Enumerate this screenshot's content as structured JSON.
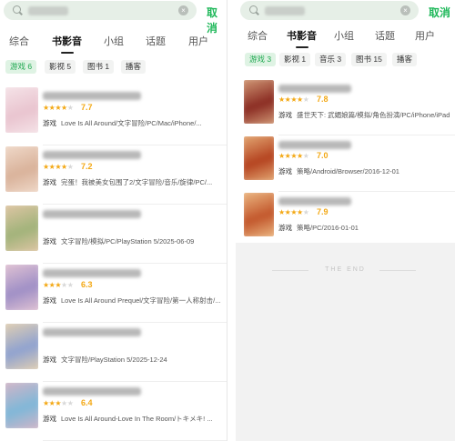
{
  "left": {
    "search": {
      "clear_glyph": "×",
      "cancel_label": "取消"
    },
    "tabs": [
      "综合",
      "书影音",
      "小组",
      "话题",
      "用户"
    ],
    "active_tab": "书影音",
    "filters": [
      "游戏 6",
      "影视 5",
      "图书 1",
      "播客"
    ],
    "active_filter": "游戏 6",
    "items": [
      {
        "stars": "★★★★",
        "stars_off": "★",
        "rating": "7.7",
        "type": "游戏",
        "meta": "Love Is All Around/文字冒险/PC/Mac/iPhone/...",
        "cover_colors": [
          "#e9c4cf",
          "#f6e6ea"
        ]
      },
      {
        "stars": "★★★★",
        "stars_off": "★",
        "rating": "7.2",
        "type": "游戏",
        "meta": "完蛋！我被美女包围了2/文字冒险/音乐/旋律/PC/...",
        "cover_colors": [
          "#d9b29a",
          "#f1dccd"
        ]
      },
      {
        "stars": "",
        "stars_off": "",
        "rating": "",
        "type": "游戏",
        "meta": "文字冒险/模拟/PC/PlayStation 5/2025-06-09",
        "cover_colors": [
          "#a1b37a",
          "#e4c7a8"
        ]
      },
      {
        "stars": "★★★",
        "stars_off": "★★",
        "rating": "6.3",
        "type": "游戏",
        "meta": "Love Is All Around Prequel/文字冒险/第一人称射击/...",
        "cover_colors": [
          "#9f8fc6",
          "#e6c7d4"
        ]
      },
      {
        "stars": "",
        "stars_off": "",
        "rating": "",
        "type": "游戏",
        "meta": "文字冒险/PlayStation 5/2025-12-24",
        "cover_colors": [
          "#8fa2d0",
          "#e8d3b0"
        ]
      },
      {
        "stars": "★★★",
        "stars_off": "★★",
        "rating": "6.4",
        "type": "游戏",
        "meta": "Love Is All Around-Love In The Room/トキメキ! ...",
        "cover_colors": [
          "#7fb7d8",
          "#d9b6c6"
        ]
      }
    ]
  },
  "right": {
    "search": {
      "clear_glyph": "×",
      "cancel_label": "取消"
    },
    "tabs": [
      "综合",
      "书影音",
      "小组",
      "话题",
      "用户"
    ],
    "active_tab": "书影音",
    "filters": [
      "游戏 3",
      "影视 1",
      "音乐 3",
      "图书 15",
      "播客"
    ],
    "active_filter": "游戏 3",
    "items": [
      {
        "stars": "★★★★",
        "stars_off": "★",
        "rating": "7.8",
        "type": "游戏",
        "meta": "盛世天下: 武媚娘篇/模拟/角色扮演/PC/iPhone/iPad/...",
        "cover_colors": [
          "#8a2b22",
          "#d7a27d"
        ]
      },
      {
        "stars": "★★★★",
        "stars_off": "★",
        "rating": "7.0",
        "type": "游戏",
        "meta": "策略/Android/Browser/2016-12-01",
        "cover_colors": [
          "#b4421f",
          "#e7b07a"
        ]
      },
      {
        "stars": "★★★★",
        "stars_off": "★",
        "rating": "7.9",
        "type": "游戏",
        "meta": "策略/PC/2016-01-01",
        "cover_colors": [
          "#c2562b",
          "#efc08a"
        ]
      }
    ],
    "end_label": "THE END"
  },
  "colors": {
    "accent": "#1fb85a",
    "star": "#f3a814",
    "chip_active_bg": "#dff3e4"
  }
}
